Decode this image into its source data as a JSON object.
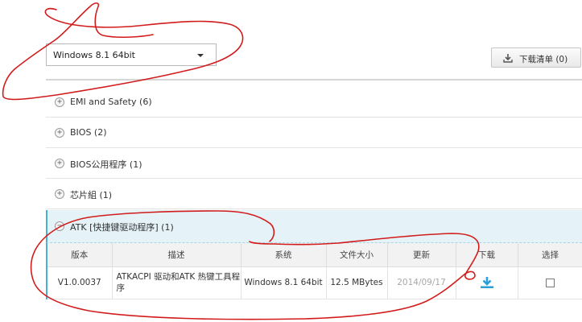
{
  "os_select": {
    "value": "Windows 8.1 64bit"
  },
  "download_list": {
    "label": "下载清单 (0)"
  },
  "categories": [
    {
      "label": "EMI and Safety  (6)",
      "toggle": "+"
    },
    {
      "label": "BIOS (2)",
      "toggle": "+"
    },
    {
      "label": "BIOS公用程序 (1)",
      "toggle": "+"
    },
    {
      "label": "芯片組 (1)",
      "toggle": "+"
    },
    {
      "label": "ATK [快捷键驱动程序] (1)",
      "toggle": "−"
    }
  ],
  "table": {
    "headers": [
      "版本",
      "描述",
      "系统",
      "文件大小",
      "更新",
      "下载",
      "选择"
    ],
    "rows": [
      {
        "version": "V1.0.0037",
        "description": "ATKACPI 驱动和ATK 热键工具程序",
        "system": "Windows 8.1 64bit",
        "size": "12.5 MBytes",
        "date": "2014/09/17"
      }
    ]
  },
  "colors": {
    "accent": "#48b0d8",
    "expanded_bg": "#e5f3f8",
    "download_icon": "#2a9fd8",
    "annotation": "#d21b1b"
  },
  "icons": {
    "download_list_button": "download-tray-icon",
    "row_download": "download-arrow-icon",
    "select_arrow": "caret-down-icon",
    "category_toggle": "circle-plus-icon"
  }
}
